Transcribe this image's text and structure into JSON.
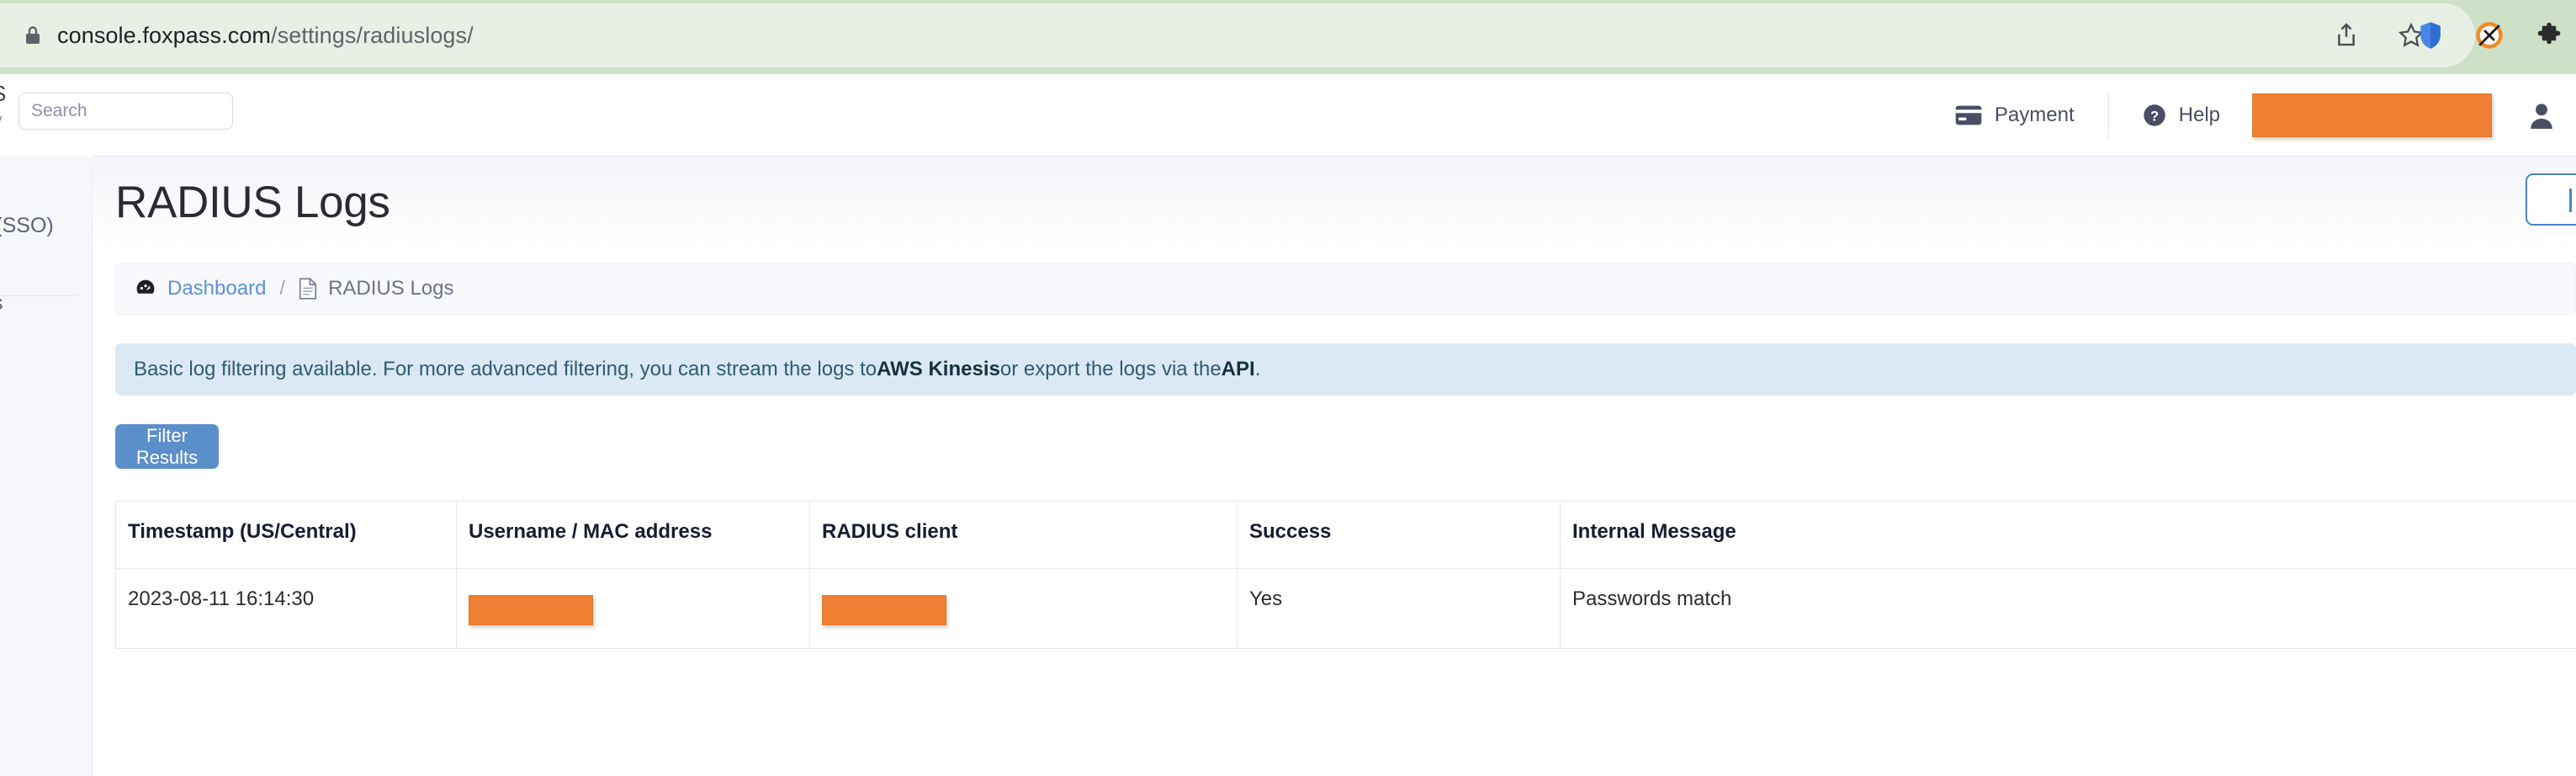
{
  "browser": {
    "url_host": "console.foxpass.com",
    "url_path": "/settings/radiuslogs/",
    "lock_icon": "lock-icon",
    "share_icon": "share-icon",
    "bookmark_icon": "star-outline-icon",
    "shield_icon": "shield-icon",
    "blocker_icon": "ad-blocker-icon",
    "extensions_icon": "puzzle-piece-icon"
  },
  "topnav": {
    "search_placeholder": "Search",
    "search_value": "",
    "payment_label": "Payment",
    "payment_icon": "credit-card-icon",
    "help_label": "Help",
    "help_icon": "question-circle-icon",
    "account_redacted": "",
    "user_icon": "user-icon"
  },
  "sidebar": {
    "fragment_top_1": "S",
    "fragment_top_2": "y",
    "fragment_sso": "On (SSO)",
    "fragment_s": "s"
  },
  "page": {
    "title": "RADIUS Logs",
    "header_action_icon": "panel-toggle-icon"
  },
  "breadcrumb": {
    "dashboard_icon": "tachometer-icon",
    "dashboard_label": "Dashboard",
    "separator": "/",
    "current_icon": "document-icon",
    "current_label": "RADIUS Logs"
  },
  "alert": {
    "text_1": "Basic log filtering available. For more advanced filtering, you can stream the logs to ",
    "link_1": "AWS Kinesis",
    "text_2": " or export the logs via the ",
    "link_2": "API",
    "text_3": "."
  },
  "toolbar": {
    "filter_button_label": "Filter Results"
  },
  "table": {
    "columns": [
      "Timestamp (US/Central)",
      "Username / MAC address",
      "RADIUS client",
      "Success",
      "Internal Message"
    ],
    "rows": [
      {
        "timestamp": "2023-08-11 16:14:30",
        "username": "",
        "client": "",
        "success": "Yes",
        "message": "Passwords match"
      }
    ]
  },
  "colors": {
    "accent_blue": "#5b8fc9",
    "link_blue": "#5b90d6",
    "success_green": "#5cb85c",
    "redaction_orange": "#ef7f32",
    "alert_bg": "#dbe9f4",
    "chrome_green": "#cfe0c8"
  }
}
